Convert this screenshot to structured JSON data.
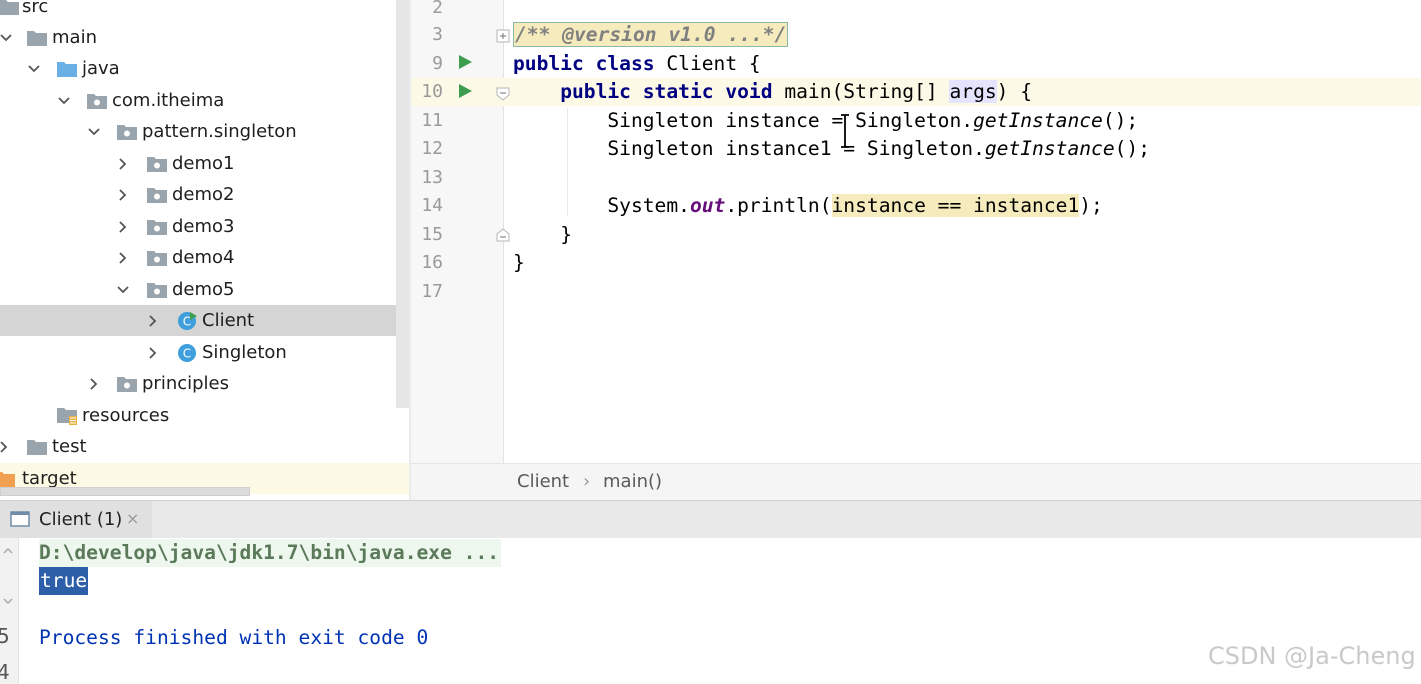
{
  "project_tree": {
    "items": [
      {
        "label": "src",
        "icon": "folder-icon"
      },
      {
        "label": "main",
        "icon": "folder-icon"
      },
      {
        "label": "java",
        "icon": "source-folder-icon"
      },
      {
        "label": "com.itheima",
        "icon": "package-icon"
      },
      {
        "label": "pattern.singleton",
        "icon": "package-icon"
      },
      {
        "label": "demo1",
        "icon": "package-icon"
      },
      {
        "label": "demo2",
        "icon": "package-icon"
      },
      {
        "label": "demo3",
        "icon": "package-icon"
      },
      {
        "label": "demo4",
        "icon": "package-icon"
      },
      {
        "label": "demo5",
        "icon": "package-icon"
      },
      {
        "label": "Client",
        "icon": "class-runnable-icon"
      },
      {
        "label": "Singleton",
        "icon": "class-icon"
      },
      {
        "label": "principles",
        "icon": "package-icon"
      },
      {
        "label": "resources",
        "icon": "resources-folder-icon"
      },
      {
        "label": "test",
        "icon": "folder-icon"
      },
      {
        "label": "target",
        "icon": "excluded-folder-icon"
      }
    ]
  },
  "editor": {
    "line_numbers": [
      "2",
      "3",
      "9",
      "10",
      "11",
      "12",
      "13",
      "14",
      "15",
      "16",
      "17"
    ],
    "code": {
      "l3_folded": "/** @version v1.0 ...*/",
      "l9_kw1": "public",
      "l9_kw2": "class",
      "l9_rest": " Client {",
      "l10_kw1": "public",
      "l10_kw2": "static",
      "l10_kw3": "void",
      "l10_mid": " main(String[] ",
      "l10_args": "args",
      "l10_end": ") {",
      "l11_a": "Singleton instance = Singleton.",
      "l11_b": "getInstance",
      "l11_c": "();",
      "l12_a": "Singleton instance1 = Singleton.",
      "l12_b": "getInstance",
      "l12_c": "();",
      "l14_a": "System.",
      "l14_out": "out",
      "l14_b": ".println(",
      "l14_expr": "instance == instance1",
      "l14_c": ");",
      "l15": "}",
      "l16": "}"
    },
    "breadcrumb": {
      "class_name": "Client",
      "separator": "›",
      "method": "main()"
    }
  },
  "run_panel": {
    "tab_label": "Client (1)",
    "close_glyph": "×",
    "lines": {
      "command": "D:\\develop\\java\\jdk1.7\\bin\\java.exe ...",
      "output": "true",
      "finished": "Process finished with exit code 0"
    },
    "left_strip_digits": [
      "5",
      "4"
    ]
  },
  "watermark": "CSDN @Ja-Cheng",
  "colors": {
    "keyword": "#000080",
    "static_field": "#660e7a",
    "console_command": "#5a7a5a",
    "console_output": "#0033b3",
    "selection_bg": "#d5d5d5",
    "folder": "#9aa4ad",
    "source_folder": "#6ab0e5",
    "excluded_folder": "#f0a050",
    "run_arrow": "#3d9d4f"
  }
}
